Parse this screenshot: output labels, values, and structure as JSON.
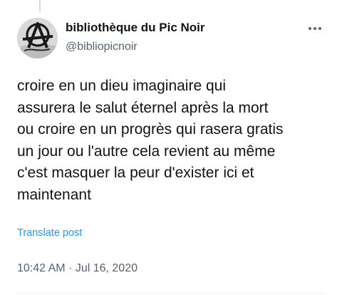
{
  "author": {
    "display_name": "bibliothèque du Pic Noir",
    "handle": "@bibliopicnoir",
    "avatar_icon": "anarchy-a-symbol-avatar"
  },
  "header": {
    "more_icon": "more-horizontal-icon"
  },
  "tweet": {
    "lines": [
      "croire en un dieu imaginaire qui",
      "assurera le salut éternel après la mort",
      "ou croire en un progrès qui rasera gratis",
      "un jour ou l'autre cela revient au même",
      "c'est masquer la peur d'exister ici et",
      "maintenant"
    ],
    "translate_label": "Translate post",
    "timestamp": "10:42 AM · Jul 16, 2020"
  },
  "colors": {
    "text_primary": "#0f1419",
    "text_secondary": "#536471",
    "link": "#1d9bf0",
    "divider": "#eff3f4"
  }
}
